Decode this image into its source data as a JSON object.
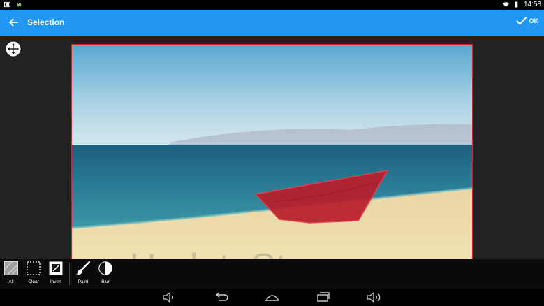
{
  "status_bar": {
    "time": "14:58"
  },
  "app_bar": {
    "title": "Selection",
    "ok_label": "OK"
  },
  "toolbar": {
    "tools": [
      {
        "label": "All",
        "icon": "select-all-icon"
      },
      {
        "label": "Clear",
        "icon": "clear-selection-icon"
      },
      {
        "label": "Invert",
        "icon": "invert-selection-icon"
      },
      {
        "label": "Paint",
        "icon": "paint-brush-icon"
      },
      {
        "label": "Blur",
        "icon": "blur-icon"
      }
    ]
  },
  "watermark": "UpdateStar.com",
  "colors": {
    "accent": "#2196f3",
    "selection": "#c0282d"
  }
}
